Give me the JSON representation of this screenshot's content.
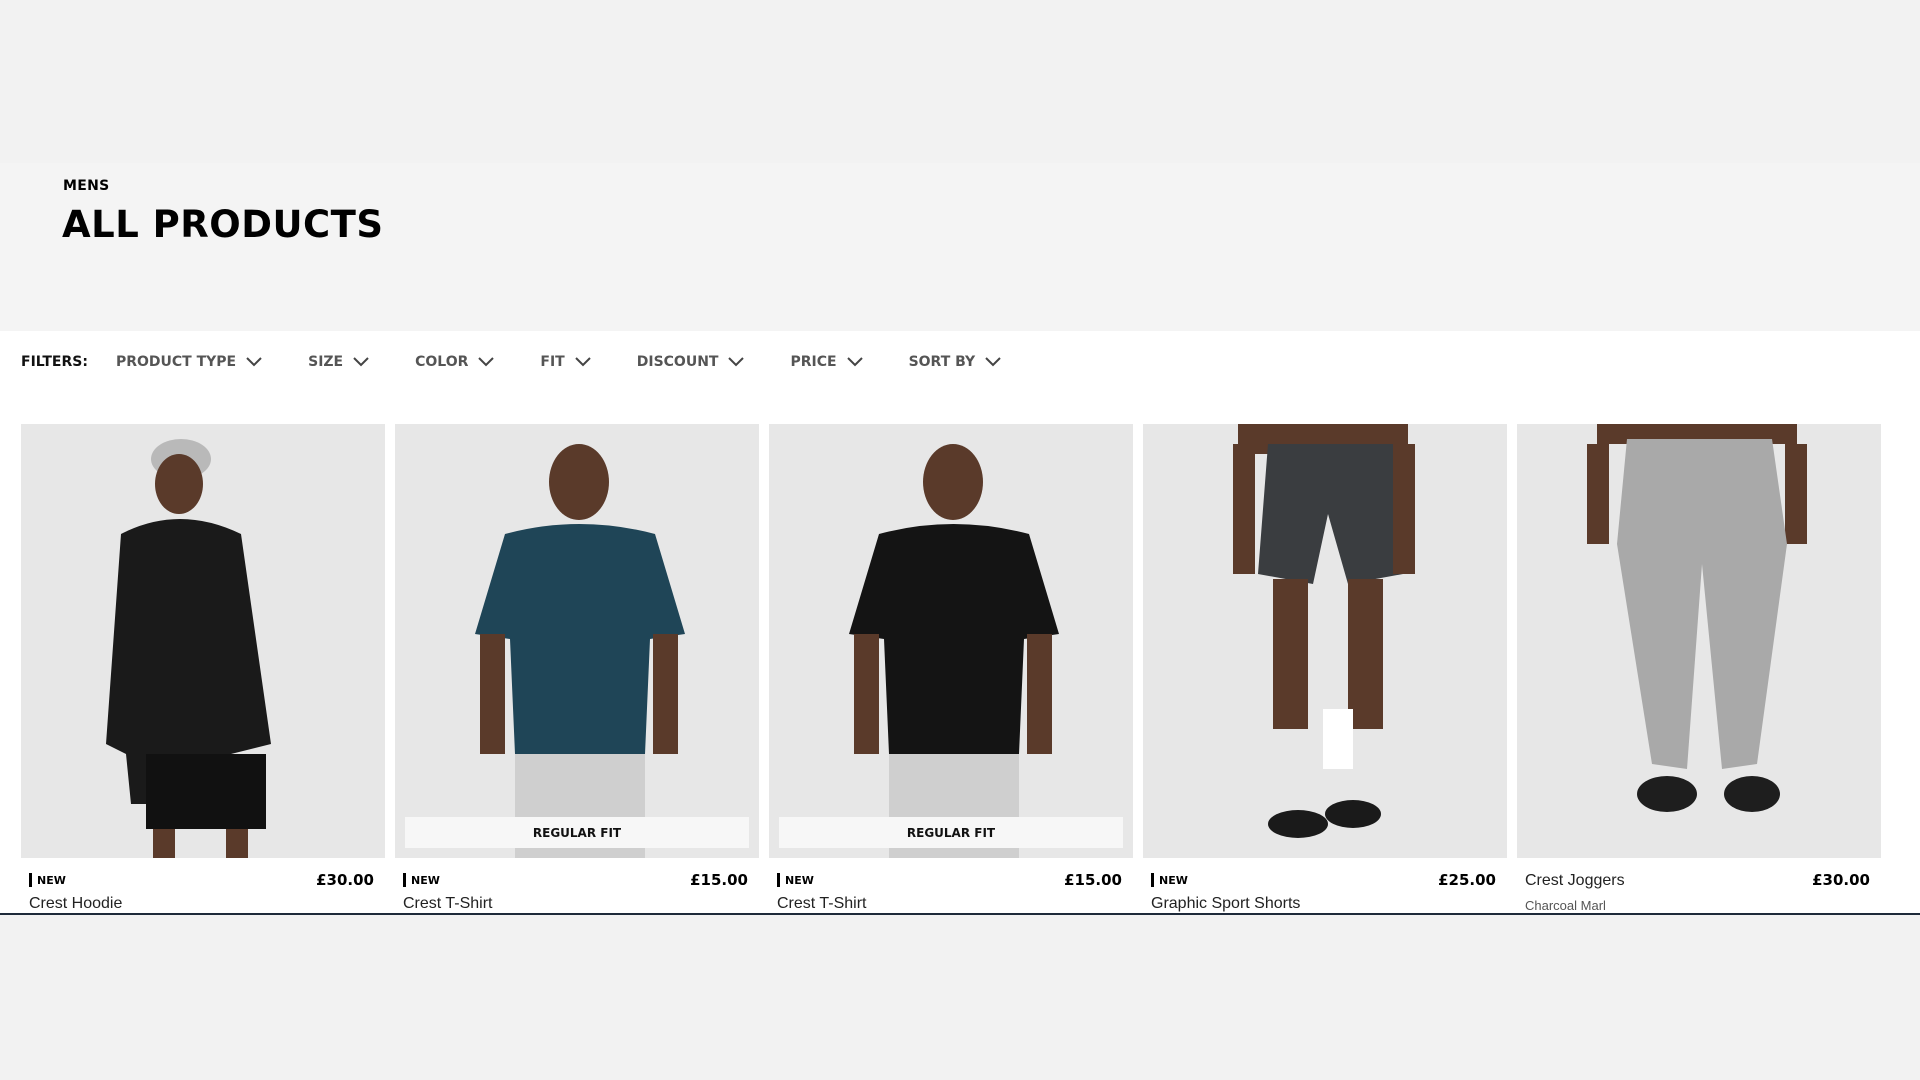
{
  "header": {
    "breadcrumb": "MENS",
    "title": "ALL PRODUCTS"
  },
  "filters": {
    "label": "FILTERS:",
    "items": [
      {
        "label": "PRODUCT TYPE",
        "icon": "chevron-down-icon"
      },
      {
        "label": "SIZE",
        "icon": "chevron-down-icon"
      },
      {
        "label": "COLOR",
        "icon": "chevron-down-icon"
      },
      {
        "label": "FIT",
        "icon": "chevron-down-icon"
      },
      {
        "label": "DISCOUNT",
        "icon": "chevron-down-icon"
      },
      {
        "label": "PRICE",
        "icon": "chevron-down-icon"
      },
      {
        "label": "SORT BY",
        "icon": "chevron-down-icon"
      }
    ]
  },
  "products": [
    {
      "tag": "NEW",
      "price": "£30.00",
      "name": "Crest Hoodie",
      "color": "",
      "badge": "",
      "garment_color": "#1a1a1a"
    },
    {
      "tag": "NEW",
      "price": "£15.00",
      "name": "Crest T-Shirt",
      "color": "",
      "badge": "REGULAR FIT",
      "garment_color": "#1f4557"
    },
    {
      "tag": "NEW",
      "price": "£15.00",
      "name": "Crest T-Shirt",
      "color": "",
      "badge": "REGULAR FIT",
      "garment_color": "#141414"
    },
    {
      "tag": "NEW",
      "price": "£25.00",
      "name": "Graphic Sport Shorts",
      "color": "",
      "badge": "",
      "garment_color": "#3a3d40"
    },
    {
      "tag": "",
      "price": "£30.00",
      "name": "Crest Joggers",
      "color": "Charcoal Marl",
      "badge": "",
      "garment_color": "#a9a9a9"
    }
  ],
  "colors": {
    "page_bg": "#f2f2f2",
    "header_bg": "#f4f4f4",
    "content_bg": "#ffffff",
    "image_bg": "#e7e7e7",
    "skin": "#5a3a2a"
  }
}
